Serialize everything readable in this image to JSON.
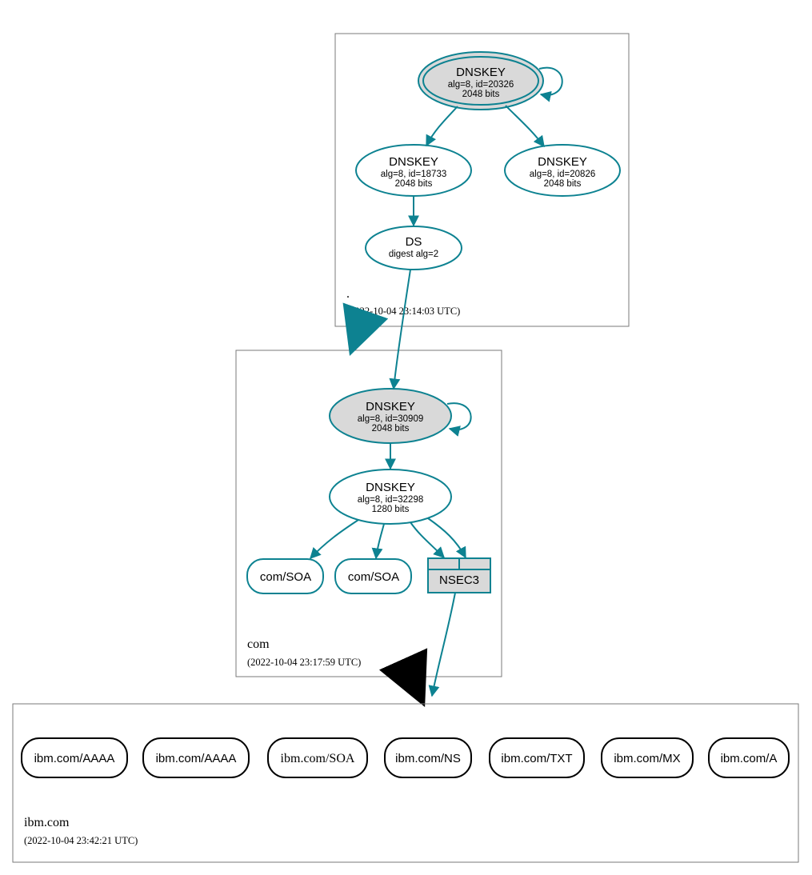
{
  "colors": {
    "teal": "#0d8291",
    "grayFill": "#d9d9d9",
    "border": "#7a7a7a",
    "black": "#000000"
  },
  "zones": {
    "root": {
      "name": ".",
      "timestamp": "(2022-10-04 23:14:03 UTC)"
    },
    "com": {
      "name": "com",
      "timestamp": "(2022-10-04 23:17:59 UTC)"
    },
    "ibm": {
      "name": "ibm.com",
      "timestamp": "(2022-10-04 23:42:21 UTC)"
    }
  },
  "nodes": {
    "root_ksk": {
      "title": "DNSKEY",
      "line1": "alg=8, id=20326",
      "line2": "2048 bits"
    },
    "root_zsk": {
      "title": "DNSKEY",
      "line1": "alg=8, id=18733",
      "line2": "2048 bits"
    },
    "root_extra": {
      "title": "DNSKEY",
      "line1": "alg=8, id=20826",
      "line2": "2048 bits"
    },
    "root_ds": {
      "title": "DS",
      "line1": "digest alg=2"
    },
    "com_ksk": {
      "title": "DNSKEY",
      "line1": "alg=8, id=30909",
      "line2": "2048 bits"
    },
    "com_zsk": {
      "title": "DNSKEY",
      "line1": "alg=8, id=32298",
      "line2": "1280 bits"
    },
    "com_soa1": {
      "label": "com/SOA"
    },
    "com_soa2": {
      "label": "com/SOA"
    },
    "com_nsec3": {
      "label": "NSEC3"
    }
  },
  "rrs": {
    "aaaa1": "ibm.com/AAAA",
    "aaaa2": "ibm.com/AAAA",
    "soa": "ibm.com/SOA",
    "ns": "ibm.com/NS",
    "txt": "ibm.com/TXT",
    "mx": "ibm.com/MX",
    "a": "ibm.com/A"
  }
}
